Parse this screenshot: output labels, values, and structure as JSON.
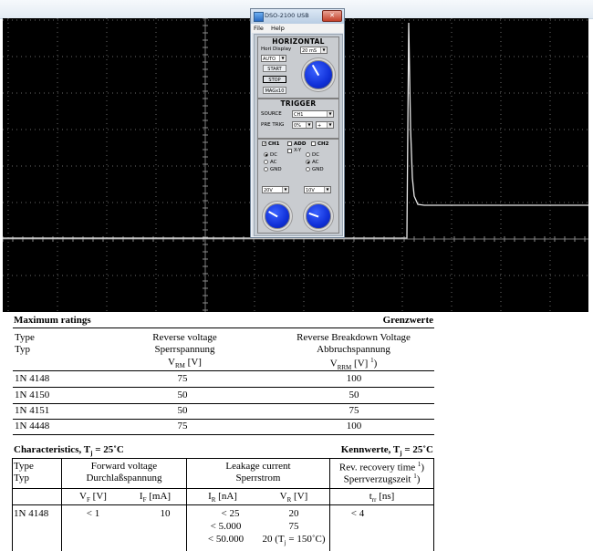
{
  "dso_window": {
    "title": "DSO-2100 USB",
    "close_glyph": "✕",
    "menu": [
      "File",
      "Help"
    ],
    "horizontal": {
      "section_title": "HORIZONTAL",
      "hori_display_label": "Hori Display",
      "hori_display_value": "20 mS",
      "mode_value": "AUTO",
      "start_label": "START",
      "stop_label": "STOP",
      "magx10_label": "MAGx10"
    },
    "trigger": {
      "section_title": "TRIGGER",
      "source_label": "SOURCE",
      "source_value": "CH1",
      "pre_trig_label": "PRE TRIG",
      "pre_trig_value": "0%",
      "slope_value": "+"
    },
    "channels": {
      "ch1_label": "CH1",
      "add_label": "ADD",
      "ch2_label": "CH2",
      "xy_label": "X-Y",
      "ch1_coupling": [
        "DC",
        "AC",
        "GND"
      ],
      "ch1_selected": "DC",
      "ch2_coupling": [
        "DC",
        "AC",
        "GND"
      ],
      "ch2_selected": "AC",
      "ch1_volts": "20V",
      "ch2_volts": "10V"
    }
  },
  "max_ratings": {
    "title_left": "Maximum ratings",
    "title_right": "Grenzwerte",
    "col_type": [
      "Type",
      "Typ"
    ],
    "col_vrm": [
      "Reverse voltage",
      "Sperrspannung",
      "V",
      "RM",
      " [V]"
    ],
    "col_vrrm": [
      "Reverse Breakdown Voltage",
      "Abbruchspannung",
      "V",
      "RRM",
      " [V] ",
      "1",
      ")"
    ],
    "rows": [
      {
        "type": "1N 4148",
        "vrm": "75",
        "vrrm": "100"
      },
      {
        "type": "1N 4150",
        "vrm": "50",
        "vrrm": "50"
      },
      {
        "type": "1N 4151",
        "vrm": "50",
        "vrrm": "75"
      },
      {
        "type": "1N 4448",
        "vrm": "75",
        "vrrm": "100"
      }
    ]
  },
  "characteristics": {
    "title_left": "Characteristics, T",
    "title_left_sub": "j",
    "title_left_tail": " = 25˚C",
    "title_right": "Kennwerte, T",
    "title_right_sub": "j",
    "title_right_tail": " = 25˚C",
    "col_type": [
      "Type",
      "Typ"
    ],
    "col_forward": [
      "Forward voltage",
      "Durchlaßspannung"
    ],
    "col_leakage": [
      "Leakage current",
      "Sperrstrom"
    ],
    "col_recovery": [
      "Rev. recovery time ",
      "1",
      ")",
      "Sperrverzugszeit ",
      "1",
      ")"
    ],
    "sub_vf": [
      "V",
      "F",
      " [V]"
    ],
    "sub_if": [
      "I",
      "F",
      " [mA]"
    ],
    "sub_ir": [
      "I",
      "R",
      " [nA]"
    ],
    "sub_vr": [
      "V",
      "R",
      " [V]"
    ],
    "sub_trr": [
      "t",
      "rr",
      " [ns]"
    ],
    "row": {
      "type": "1N 4148",
      "vf": "< 1",
      "if": "10",
      "ir": [
        "< 25",
        "< 5.000",
        "< 50.000"
      ],
      "vr": [
        "20",
        "75",
        "20 (T",
        "j",
        " = 150˚C)"
      ],
      "trr": "< 4"
    }
  }
}
